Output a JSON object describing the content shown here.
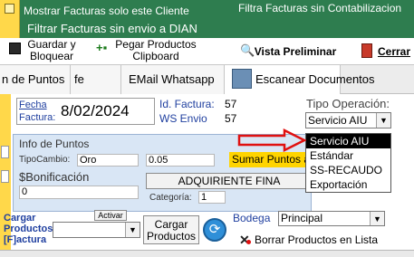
{
  "banner": {
    "mostrar_label": "Mostrar Facturas solo este Cliente",
    "filtrar_dian_label": "Filtrar Facturas sin envio a DIAN",
    "filtra_contab_label": "Filtra Facturas sin Contabilizacion"
  },
  "toolbar": {
    "guardar_label_1": "Guardar y",
    "guardar_label_2": "Bloquear",
    "pegar_label_1": "Pegar Productos",
    "pegar_label_2": "Clipboard",
    "vista_label": "Vista Preliminar",
    "cerrar_label": "Cerrar"
  },
  "tabs": [
    {
      "label": "n de Puntos"
    },
    {
      "label": "fe"
    },
    {
      "label": "EMail Whatsapp"
    },
    {
      "label": "Escanear Documentos"
    }
  ],
  "form": {
    "fecha_label_1": "Fecha",
    "fecha_label_2": "Factura:",
    "fecha_value": "8/02/2024",
    "id_factura_label": "Id. Factura:",
    "id_factura_value": "57",
    "ws_envio_label": "WS Envio",
    "ws_envio_value": "57",
    "tipo_operacion_label": "Tipo Operación:",
    "tipo_operacion_value": "Servicio AIU",
    "tipo_operacion_options": [
      "Servicio AIU",
      "Estándar",
      "SS-RECAUDO",
      "Exportación"
    ]
  },
  "puntos": {
    "title": "Info de Puntos",
    "tipo_cambio_label": "TipoCambio:",
    "tipo_cambio_value": "Oro",
    "rate_value": "0.05",
    "sumar_label": "Sumar Puntos a",
    "bonificacion_label": "$Bonificación",
    "bonificacion_value": "0",
    "adquiriente_label": "ADQUIRIENTE FINA",
    "categoria_label": "Categoría:",
    "categoria_value": "1"
  },
  "bottom": {
    "cargar_label_1": "Cargar",
    "cargar_label_2": "Productos",
    "cargar_label_3": "[F]actura",
    "activar_label": "Activar",
    "cargar_productos_btn_1": "Cargar",
    "cargar_productos_btn_2": "Productos",
    "bodega_label": "Bodega",
    "bodega_value": "Principal",
    "borrar_label": "Borrar Productos en Lista"
  },
  "colors": {
    "banner_green": "#2e7d4f",
    "stripe_yellow": "#ffd84a",
    "label_blue": "#1f3f9f",
    "arrow_red": "#e01010"
  }
}
